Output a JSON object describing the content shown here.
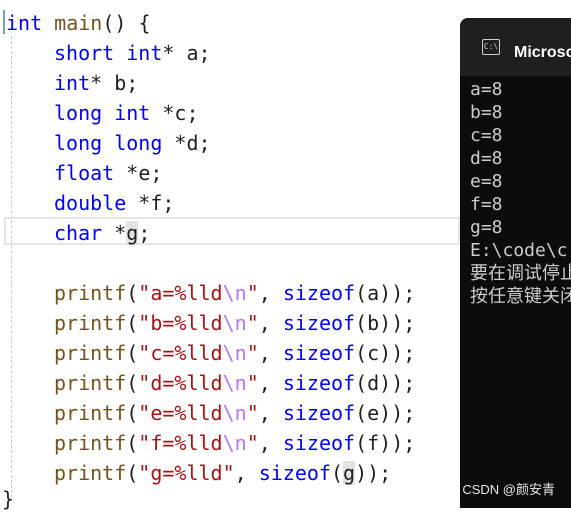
{
  "editor": {
    "line0": {
      "kw": "int",
      "fn": "main",
      "rest": "() {"
    },
    "decls": [
      {
        "type": "short int",
        "ptr": "* ",
        "name": "a",
        "semi": ";"
      },
      {
        "type": "int",
        "ptr": "* ",
        "name": "b",
        "semi": ";"
      },
      {
        "type": "long int",
        "ptr": " *",
        "name": "c",
        "semi": ";"
      },
      {
        "type": "long long",
        "ptr": " *",
        "name": "d",
        "semi": ";"
      },
      {
        "type": "float",
        "ptr": " *",
        "name": "e",
        "semi": ";"
      },
      {
        "type": "double",
        "ptr": " *",
        "name": "f",
        "semi": ";"
      },
      {
        "type": "char",
        "ptr": " *",
        "name": "g",
        "semi": ";"
      }
    ],
    "printfs": [
      {
        "fn": "printf",
        "open": "(",
        "str1": "\"a=%lld",
        "esc": "\\n",
        "str2": "\"",
        "comma": ", ",
        "op": "sizeof",
        "arg": "(a)",
        "close": ");"
      },
      {
        "fn": "printf",
        "open": "(",
        "str1": "\"b=%lld",
        "esc": "\\n",
        "str2": "\"",
        "comma": ", ",
        "op": "sizeof",
        "arg": "(b)",
        "close": ");"
      },
      {
        "fn": "printf",
        "open": "(",
        "str1": "\"c=%lld",
        "esc": "\\n",
        "str2": "\"",
        "comma": ", ",
        "op": "sizeof",
        "arg": "(c)",
        "close": ");"
      },
      {
        "fn": "printf",
        "open": "(",
        "str1": "\"d=%lld",
        "esc": "\\n",
        "str2": "\"",
        "comma": ", ",
        "op": "sizeof",
        "arg": "(d)",
        "close": ");"
      },
      {
        "fn": "printf",
        "open": "(",
        "str1": "\"e=%lld",
        "esc": "\\n",
        "str2": "\"",
        "comma": ", ",
        "op": "sizeof",
        "arg": "(e)",
        "close": ");"
      },
      {
        "fn": "printf",
        "open": "(",
        "str1": "\"f=%lld",
        "esc": "\\n",
        "str2": "\"",
        "comma": ", ",
        "op": "sizeof",
        "arg": "(f)",
        "close": ");"
      }
    ],
    "last_printf": {
      "fn": "printf",
      "open": "(",
      "str1": "\"g=%lld\"",
      "comma": ", ",
      "op": "sizeof",
      "p1": "(",
      "arg": "g",
      "p2": ")",
      "close": ");"
    },
    "closing": "}"
  },
  "console": {
    "icon_label": "C:\\",
    "title": "Microsoft Visual Studio 调试控制台",
    "output": [
      "a=8",
      "b=8",
      "c=8",
      "d=8",
      "e=8",
      "f=8",
      "g=8",
      "E:\\code\\c",
      "要在调试停止时",
      "按任意键关闭"
    ]
  },
  "watermark": "CSDN @颜安青",
  "colors": {
    "keyword": "#0000ff",
    "function": "#74531f",
    "string": "#a31515",
    "escape": "#b776fb",
    "console_bg": "#0c0c0c"
  }
}
